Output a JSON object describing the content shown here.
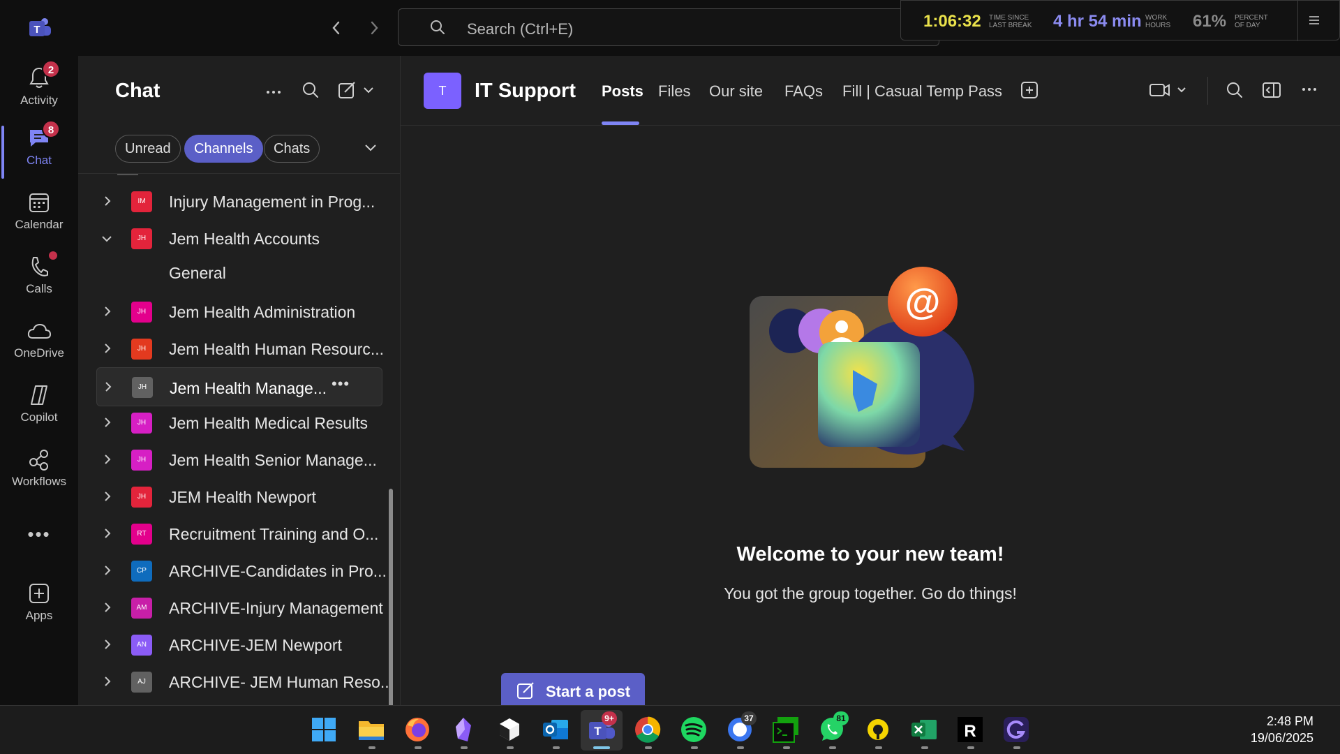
{
  "titlebar": {
    "search_placeholder": "Search (Ctrl+E)",
    "break_widget": {
      "time_since_break": "1:06:32",
      "time_since_break_label": "TIME SINCE LAST BREAK",
      "work_hours": "4 hr 54 min",
      "work_hours_label": "WORK HOURS",
      "percent_of_day": "61%",
      "percent_of_day_label": "PERCENT OF DAY"
    }
  },
  "rail": {
    "items": [
      {
        "label": "Activity",
        "badge": "2"
      },
      {
        "label": "Chat",
        "badge": "8"
      },
      {
        "label": "Calendar"
      },
      {
        "label": "Calls"
      },
      {
        "label": "OneDrive"
      },
      {
        "label": "Copilot"
      },
      {
        "label": "Workflows"
      },
      {
        "label": "Apps"
      }
    ],
    "active": "Chat"
  },
  "chat_pane": {
    "title": "Chat",
    "filters": [
      "Unread",
      "Channels",
      "Chats"
    ],
    "active_filter": "Channels",
    "channels": [
      {
        "initials": "IM",
        "name": "Injury Management in Prog...",
        "color": "#e3243b",
        "expanded": false
      },
      {
        "initials": "JH",
        "name": "Jem Health Accounts",
        "color": "#e3243b",
        "expanded": true
      },
      {
        "initials": "",
        "name": "General",
        "color": "",
        "child": true
      },
      {
        "initials": "JH",
        "name": "Jem Health Administration",
        "color": "#e3008c",
        "expanded": false
      },
      {
        "initials": "JH",
        "name": "Jem Health Human Resourc...",
        "color": "#e33a1f",
        "expanded": false
      },
      {
        "initials": "JH",
        "name": "Jem Health Manage...",
        "color": "#616161",
        "expanded": false,
        "selected": true
      },
      {
        "initials": "JH",
        "name": "Jem Health Medical Results",
        "color": "#d61fc4",
        "expanded": false
      },
      {
        "initials": "JH",
        "name": "Jem Health Senior Manage...",
        "color": "#d61fc4",
        "expanded": false
      },
      {
        "initials": "JH",
        "name": "JEM Health Newport",
        "color": "#e3243b",
        "expanded": false
      },
      {
        "initials": "RT",
        "name": "Recruitment Training and O...",
        "color": "#e3008c",
        "expanded": false
      },
      {
        "initials": "CP",
        "name": "ARCHIVE-Candidates in Pro...",
        "color": "#0f6cbd",
        "expanded": false
      },
      {
        "initials": "AM",
        "name": "ARCHIVE-Injury Management",
        "color": "#c81fa8",
        "expanded": false
      },
      {
        "initials": "AN",
        "name": "ARCHIVE-JEM Newport",
        "color": "#8b5cf6",
        "expanded": false
      },
      {
        "initials": "AJ",
        "name": "ARCHIVE- JEM Human Reso...",
        "color": "#616161",
        "expanded": false
      }
    ]
  },
  "main": {
    "team_initial": "T",
    "team_name": "IT Support",
    "tabs": [
      "Posts",
      "Files",
      "Our site",
      "FAQs",
      "Fill | Casual Temp Pass"
    ],
    "active_tab": "Posts",
    "welcome_title": "Welcome to your new team!",
    "welcome_subtitle": "You got the group together. Go do things!",
    "start_post_label": "Start a post"
  },
  "taskbar": {
    "apps": [
      {
        "icon": "windows-start-icon"
      },
      {
        "icon": "file-explorer-icon"
      },
      {
        "icon": "firefox-icon"
      },
      {
        "icon": "obsidian-icon"
      },
      {
        "icon": "notion-icon"
      },
      {
        "icon": "outlook-icon"
      },
      {
        "icon": "teams-icon",
        "badge": "9+"
      },
      {
        "icon": "chrome-icon"
      },
      {
        "icon": "spotify-icon"
      },
      {
        "icon": "signal-icon",
        "badge": "37"
      },
      {
        "icon": "terminal-icon"
      },
      {
        "icon": "whatsapp-icon",
        "badge": "81"
      },
      {
        "icon": "bitwarden-icon"
      },
      {
        "icon": "excel-icon"
      },
      {
        "icon": "r-app-icon"
      },
      {
        "icon": "g-app-icon"
      }
    ],
    "time": "2:48 PM",
    "date": "19/06/2025"
  },
  "colors": {
    "accent": "#5b5fc7",
    "accent_light": "#7f85f5",
    "badge_red": "#c4314b",
    "break_time_yellow": "#e9e14b",
    "work_hours_purple": "#8b8bf0"
  }
}
